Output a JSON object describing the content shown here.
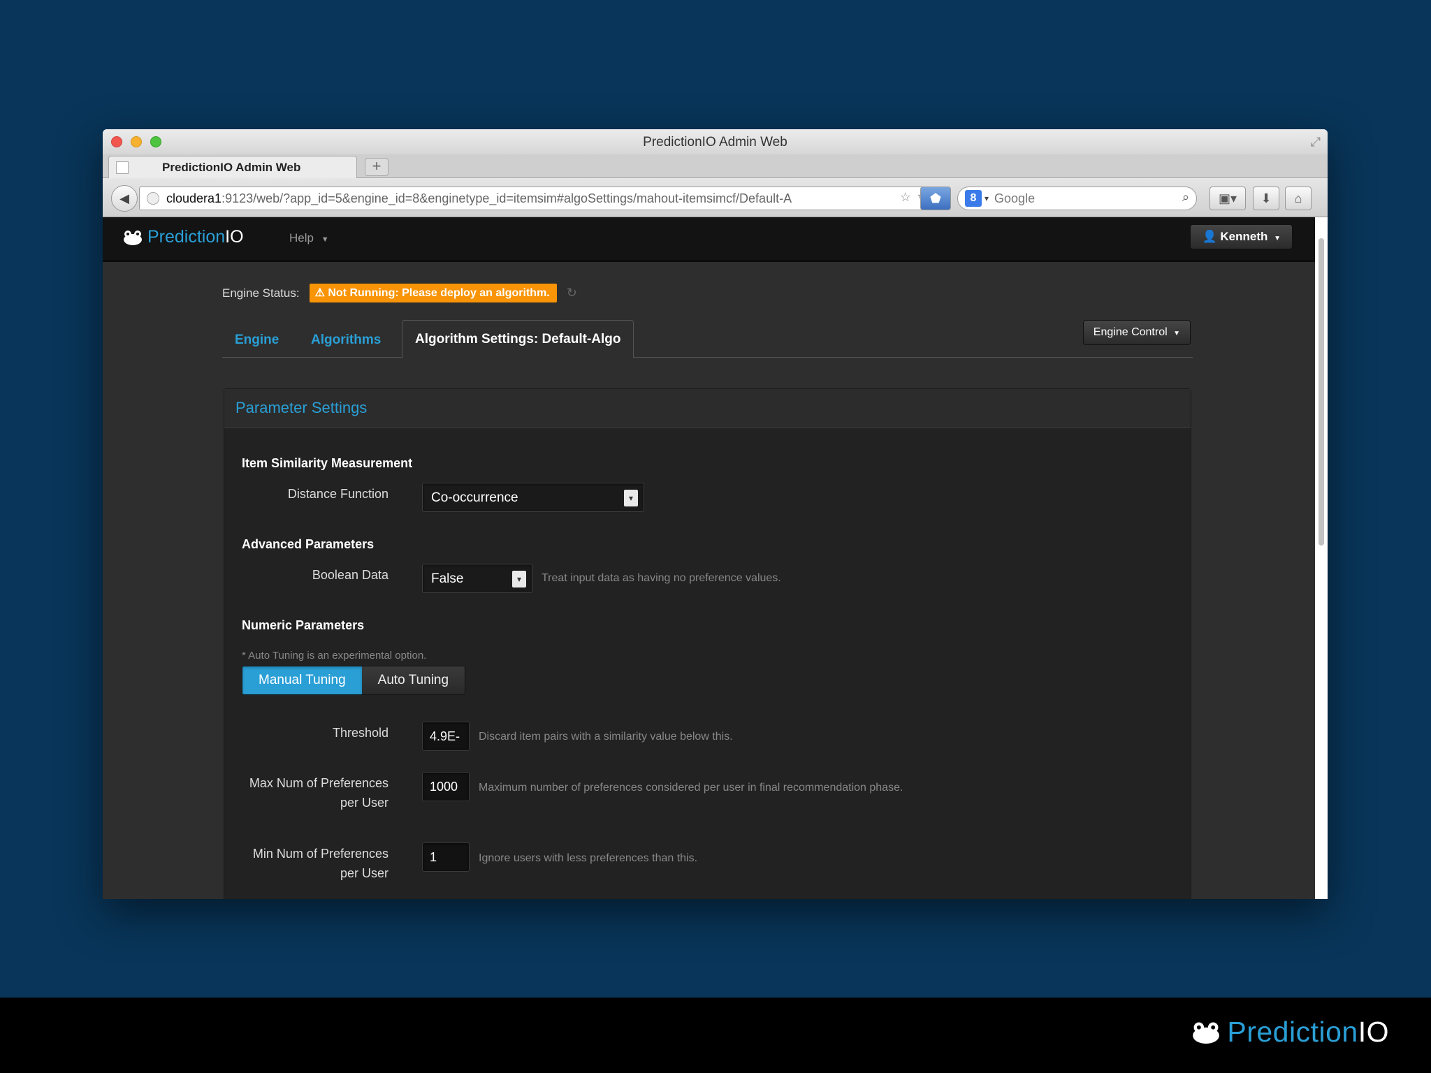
{
  "window": {
    "title": "PredictionIO Admin Web",
    "tab_title": "PredictionIO Admin Web",
    "url_host": "cloudera1",
    "url_rest": ":9123/web/?app_id=5&engine_id=8&enginetype_id=itemsim#algoSettings/mahout-itemsimcf/Default-A",
    "search_placeholder": "Google"
  },
  "navbar": {
    "brand_prefix": "Prediction",
    "brand_suffix": "IO",
    "help_label": "Help",
    "user_label": "Kenneth"
  },
  "status": {
    "label": "Engine Status:",
    "badge": "Not Running: Please deploy an algorithm.",
    "badge_color": "#f89406"
  },
  "tabs": {
    "engine": "Engine",
    "algorithms": "Algorithms",
    "active": "Algorithm Settings: Default-Algo",
    "engine_control": "Engine Control"
  },
  "panel": {
    "title": "Parameter Settings",
    "similarity": {
      "heading": "Item Similarity Measurement",
      "distance_label": "Distance Function",
      "distance_value": "Co-occurrence"
    },
    "advanced": {
      "heading": "Advanced Parameters",
      "boolean_label": "Boolean Data",
      "boolean_value": "False",
      "boolean_help": "Treat input data as having no preference values."
    },
    "numeric": {
      "heading": "Numeric Parameters",
      "note": "* Auto Tuning is an experimental option.",
      "manual": "Manual Tuning",
      "auto": "Auto Tuning",
      "threshold_label": "Threshold",
      "threshold_value": "4.9E-",
      "threshold_help": "Discard item pairs with a similarity value below this.",
      "maxpref_label_1": "Max Num of Preferences",
      "maxpref_label_2": "per User",
      "maxpref_value": "1000",
      "maxpref_help": "Maximum number of preferences considered per user in final recommendation phase.",
      "minpref_label_1": "Min Num of Preferences",
      "minpref_label_2": "per User",
      "minpref_value": "1",
      "minpref_help": "Ignore users with less preferences than this."
    }
  },
  "footer": {
    "brand_prefix": "Prediction",
    "brand_suffix": "IO"
  },
  "colors": {
    "slide_bg": "#083559",
    "accent": "#2a9fd6",
    "warning": "#f89406"
  }
}
